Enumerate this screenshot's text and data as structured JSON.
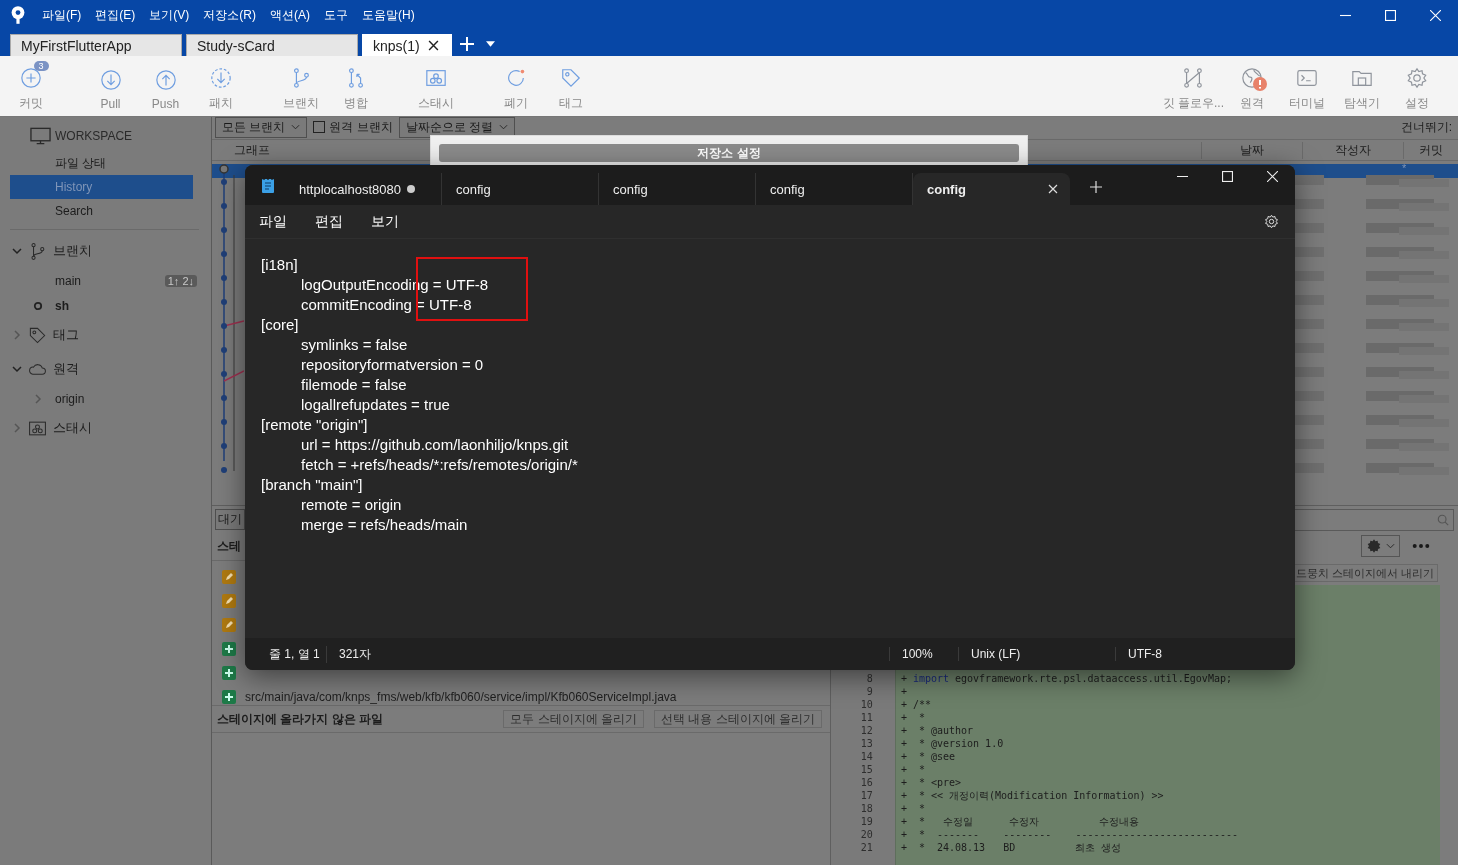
{
  "app": {
    "menus": [
      "파일(F)",
      "편집(E)",
      "보기(V)",
      "저장소(R)",
      "액션(A)",
      "도구",
      "도움말(H)"
    ]
  },
  "repo_tabs": [
    {
      "label": "MyFirstFlutterApp",
      "selected": false
    },
    {
      "label": "Study-sCard",
      "selected": false
    },
    {
      "label": "knps(1)",
      "selected": true
    }
  ],
  "toolbar": {
    "left": [
      {
        "label": "커밋",
        "kind": "commit",
        "badge": "3"
      },
      {
        "label": "Pull",
        "kind": "pull"
      },
      {
        "label": "Push",
        "kind": "push"
      },
      {
        "label": "패치",
        "kind": "fetch"
      },
      {
        "label": "브랜치",
        "kind": "branch"
      },
      {
        "label": "병합",
        "kind": "merge"
      },
      {
        "label": "스태시",
        "kind": "stash"
      },
      {
        "label": "폐기",
        "kind": "discard"
      },
      {
        "label": "태그",
        "kind": "tag"
      }
    ],
    "right": [
      {
        "label": "깃 플로우...",
        "kind": "gitflow",
        "alert": false
      },
      {
        "label": "원격",
        "kind": "globe",
        "alert": true
      },
      {
        "label": "터미널",
        "kind": "terminal",
        "alert": false
      },
      {
        "label": "탐색기",
        "kind": "folder",
        "alert": false
      },
      {
        "label": "설정",
        "kind": "gear",
        "alert": false
      }
    ]
  },
  "sidebar": {
    "workspace": "WORKSPACE",
    "items": [
      {
        "label": "파일 상태",
        "selected": false
      },
      {
        "label": "History",
        "selected": true
      },
      {
        "label": "Search",
        "selected": false
      }
    ],
    "sections": [
      {
        "label": "브랜치",
        "kind": "branch",
        "expanded": true,
        "children": [
          {
            "label": "main",
            "current": false,
            "badge": "1↑ 2↓"
          },
          {
            "label": "sh",
            "current": true
          }
        ]
      },
      {
        "label": "태그",
        "kind": "tag",
        "expanded": false
      },
      {
        "label": "원격",
        "kind": "cloud",
        "expanded": true,
        "children": [
          {
            "label": "origin",
            "current": false,
            "expanded": false
          }
        ]
      },
      {
        "label": "스태시",
        "kind": "stash",
        "expanded": false
      }
    ]
  },
  "history": {
    "branch_filter": "모든 브랜치",
    "remote_branches": {
      "label": "원격 브랜치",
      "checked": false
    },
    "sort": "날짜순으로 정렬",
    "jump_label": "건너뛰기:",
    "columns": [
      "그래프",
      "날짜",
      "작성자",
      "커밋"
    ],
    "selected_commit": "*"
  },
  "staging": {
    "pending_button": "대기",
    "staged_header": "스테",
    "staged_files": [
      {
        "kind": "modified"
      },
      {
        "kind": "modified"
      },
      {
        "kind": "modified"
      },
      {
        "kind": "added"
      },
      {
        "kind": "added"
      },
      {
        "kind": "added",
        "path": "src/main/java/com/knps_fms/web/kfb/kfb060/service/impl/Kfb060ServiceImpl.java"
      }
    ],
    "unstaged_header": "스테이지에 올라가지 않은 파일",
    "stage_all": "모두 스테이지에 올리기",
    "stage_selected": "선택 내용 스테이지에 올리기"
  },
  "diff": {
    "unstage_button": "드뭉치 스테이지에서 내리기",
    "lines": [
      {
        "num": "8",
        "sign": "+",
        "keyword": "import",
        "text": " egovframework.rte.psl.dataaccess.util.EgovMap;"
      },
      {
        "num": "9",
        "sign": "+"
      },
      {
        "num": "10",
        "sign": "+",
        "text": "/**"
      },
      {
        "num": "11",
        "sign": "+",
        "text": " *"
      },
      {
        "num": "12",
        "sign": "+",
        "text": " * @author"
      },
      {
        "num": "13",
        "sign": "+",
        "text": " * @version 1.0"
      },
      {
        "num": "14",
        "sign": "+",
        "text": " * @see"
      },
      {
        "num": "15",
        "sign": "+",
        "text": " *"
      },
      {
        "num": "16",
        "sign": "+",
        "text": " * <pre>"
      },
      {
        "num": "17",
        "sign": "+",
        "text": " * << 개정이력(Modification Information) >>"
      },
      {
        "num": "18",
        "sign": "+",
        "text": " *"
      },
      {
        "num": "19",
        "sign": "+",
        "text": " *   수정일      수정자          수정내용"
      },
      {
        "num": "20",
        "sign": "+",
        "text": " *  -------    --------    ---------------------------"
      },
      {
        "num": "21",
        "sign": "+",
        "text": " *  24.08.13   BD          최초 생성"
      }
    ]
  },
  "settings_dialog": {
    "title": "저장소 설정"
  },
  "notepad": {
    "tabs": [
      {
        "label": "httplocalhost8080",
        "modified": true,
        "selected": false
      },
      {
        "label": "config",
        "modified": false,
        "selected": false
      },
      {
        "label": "config",
        "modified": false,
        "selected": false
      },
      {
        "label": "config",
        "modified": false,
        "selected": false
      },
      {
        "label": "config",
        "selected": true
      }
    ],
    "menus": [
      "파일",
      "편집",
      "보기"
    ],
    "sections": [
      {
        "header": "[i18n]",
        "entries": [
          "logOutputEncoding = UTF-8",
          "commitEncoding = UTF-8"
        ]
      },
      {
        "header": "[core]",
        "entries": [
          "symlinks = false",
          "repositoryformatversion = 0",
          "filemode = false",
          "logallrefupdates = true"
        ]
      },
      {
        "header": "[remote \"origin\"]",
        "entries": [
          "url = https://github.com/laonhiljo/knps.git",
          "fetch = +refs/heads/*:refs/remotes/origin/*"
        ]
      },
      {
        "header": "[branch \"main\"]",
        "entries": [
          "remote = origin",
          "merge = refs/heads/main"
        ]
      }
    ],
    "status": {
      "position": "줄 1, 열 1",
      "chars": "321자",
      "zoom": "100%",
      "line_ending": "Unix (LF)",
      "encoding": "UTF-8"
    }
  }
}
